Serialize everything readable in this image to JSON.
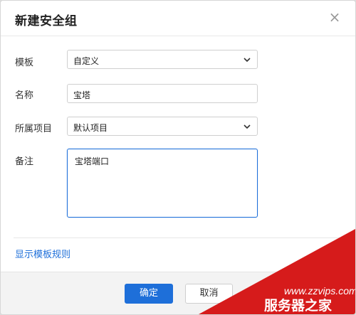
{
  "dialog": {
    "title": "新建安全组",
    "close_glyph": "×"
  },
  "form": {
    "template": {
      "label": "模板",
      "value": "自定义",
      "icon": "chevron-down-icon"
    },
    "name": {
      "label": "名称",
      "value": "宝塔"
    },
    "project": {
      "label": "所属项目",
      "value": "默认项目",
      "icon": "chevron-down-icon"
    },
    "note": {
      "label": "备注",
      "value": "宝塔端口"
    }
  },
  "links": {
    "show_template_rules": "显示模板规则"
  },
  "footer": {
    "confirm_label": "确定",
    "cancel_label": "取消"
  },
  "watermark": {
    "line1": "www.zzvips.com",
    "line2": "服务器之家"
  },
  "colors": {
    "accent": "#1e6fd9",
    "watermark_red": "#d61b1b"
  }
}
